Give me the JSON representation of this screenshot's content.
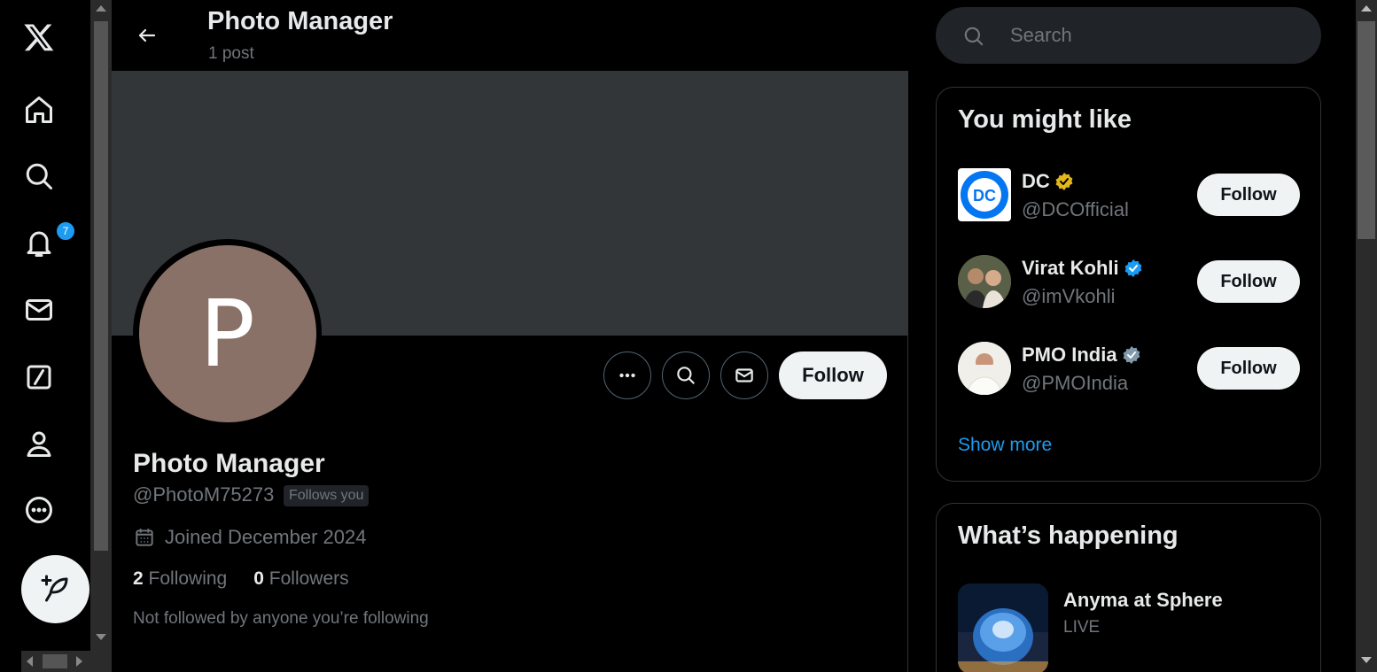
{
  "nav": {
    "items": [
      "x-logo",
      "home",
      "explore",
      "notifications",
      "messages",
      "grok",
      "profile",
      "more"
    ],
    "notifications_badge": "7"
  },
  "header": {
    "title": "Photo Manager",
    "post_count": "1 post"
  },
  "profile": {
    "avatar_letter": "P",
    "avatar_color": "#8a7168",
    "name": "Photo Manager",
    "handle": "@PhotoM75273",
    "follows_you": "Follows you",
    "joined": "Joined December 2024",
    "following_count": "2",
    "following_label": "Following",
    "followers_count": "0",
    "followers_label": "Followers",
    "not_followed": "Not followed by anyone you’re following",
    "follow_label": "Follow"
  },
  "search": {
    "placeholder": "Search"
  },
  "you_might_like": {
    "title": "You might like",
    "suggestions": [
      {
        "name": "DC",
        "handle": "@DCOfficial",
        "badge": "gold",
        "follow_label": "Follow"
      },
      {
        "name": "Virat Kohli",
        "handle": "@imVkohli",
        "badge": "blue",
        "follow_label": "Follow"
      },
      {
        "name": "PMO India",
        "handle": "@PMOIndia",
        "badge": "grey",
        "follow_label": "Follow"
      }
    ],
    "show_more": "Show more"
  },
  "whats_happening": {
    "title": "What’s happening",
    "trend_name": "Anyma at Sphere",
    "trend_status": "LIVE"
  },
  "colors": {
    "accent": "#1d9bf0",
    "gold_badge": "#e2b719",
    "grey_badge": "#829aab",
    "banner": "#333639"
  }
}
